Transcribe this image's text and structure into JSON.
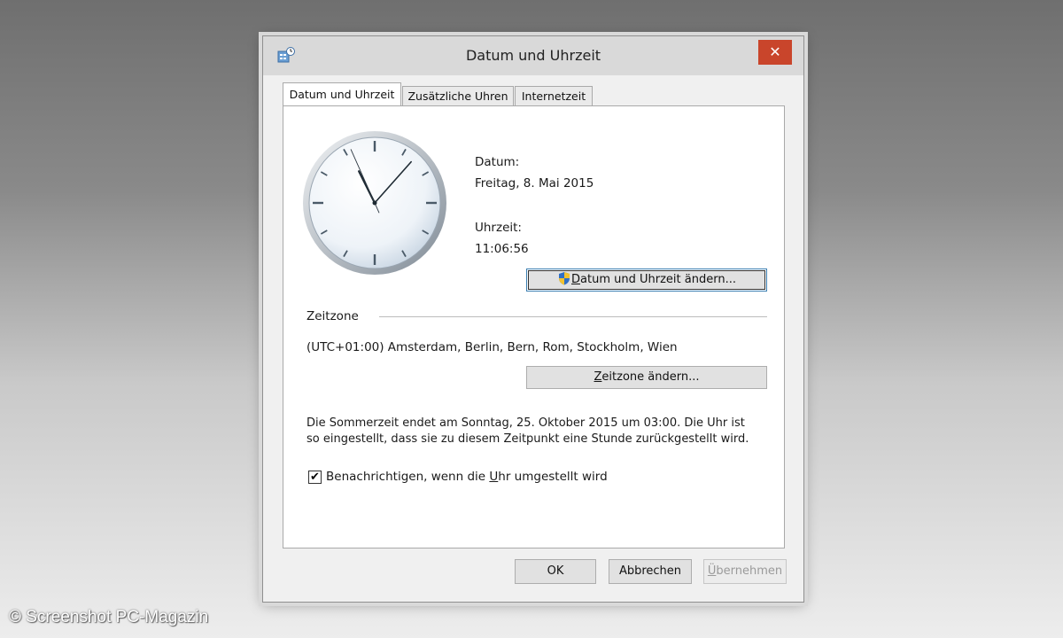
{
  "window": {
    "title": "Datum und Uhrzeit",
    "close_glyph": "✕",
    "app_icon": "clock-settings-icon"
  },
  "tabs": [
    {
      "label": "Datum und Uhrzeit",
      "active": true
    },
    {
      "label": "Zusätzliche Uhren",
      "active": false
    },
    {
      "label": "Internetzeit",
      "active": false
    }
  ],
  "date_time": {
    "date_label": "Datum:",
    "date_value": "Freitag, 8. Mai 2015",
    "time_label": "Uhrzeit:",
    "time_value": "11:06:56",
    "change_button": {
      "pre": "",
      "mnemonic": "D",
      "post": "atum und Uhrzeit ändern..."
    },
    "clock": {
      "hours": 11,
      "minutes": 6,
      "seconds": 56
    }
  },
  "timezone": {
    "heading": "Zeitzone",
    "value": "(UTC+01:00) Amsterdam, Berlin, Bern, Rom, Stockholm, Wien",
    "change_button": {
      "pre": "",
      "mnemonic": "Z",
      "post": "eitzone ändern..."
    }
  },
  "dst_info": {
    "line1": "Die Sommerzeit endet am Sonntag, 25. Oktober 2015 um 03:00. Die Uhr ist",
    "line2": "so eingestellt, dass sie zu diesem Zeitpunkt eine Stunde zurückgestellt wird."
  },
  "notify": {
    "checked": true,
    "check_glyph": "✔",
    "label_pre": "Benachrichtigen, wenn die ",
    "label_mnemonic": "U",
    "label_post": "hr umgestellt wird"
  },
  "footer": {
    "ok": "OK",
    "cancel": "Abbrechen",
    "apply_mnemonic": "Ü",
    "apply_post": "bernehmen"
  },
  "watermark": "© Screenshot PC-Magazin",
  "colors": {
    "close_button": "#c9452b",
    "title_bar": "#d9d9d9",
    "panel": "#ffffff"
  }
}
